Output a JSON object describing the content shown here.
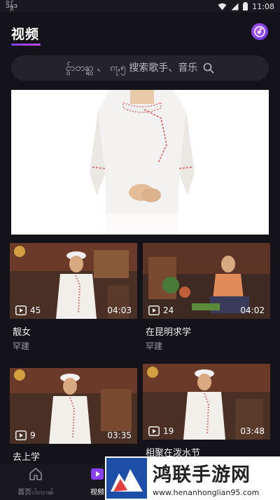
{
  "status_bar": {
    "carrier": "ဒိန္ဂ်ဒ",
    "time": "11:08"
  },
  "header": {
    "title": "视频"
  },
  "search": {
    "placeholder": "ငွ်ာတန္ရွာ 、 ၵႃႇ၅ 搜索歌手、音乐"
  },
  "videos": [
    {
      "title": "靓女",
      "artist": "罕建",
      "plays": "45",
      "duration": "04:03"
    },
    {
      "title": "在昆明求学",
      "artist": "罕建",
      "plays": "24",
      "duration": "04:02"
    },
    {
      "title": "去上学",
      "artist": "",
      "plays": "9",
      "duration": "03:35"
    },
    {
      "title": "相聚在泼水节",
      "artist": "",
      "plays": "19",
      "duration": "03:48"
    }
  ],
  "tab_bar": {
    "tabs": [
      {
        "label": "首页ငါးၸၢၼ်"
      },
      {
        "label": "视频"
      }
    ]
  },
  "watermark": {
    "name": "鸿联手游网",
    "url": "www.henanhonglian95.com"
  },
  "colors": {
    "accent": "#8a3ff2",
    "background": "#15131a",
    "card_surface": "#24222a"
  }
}
